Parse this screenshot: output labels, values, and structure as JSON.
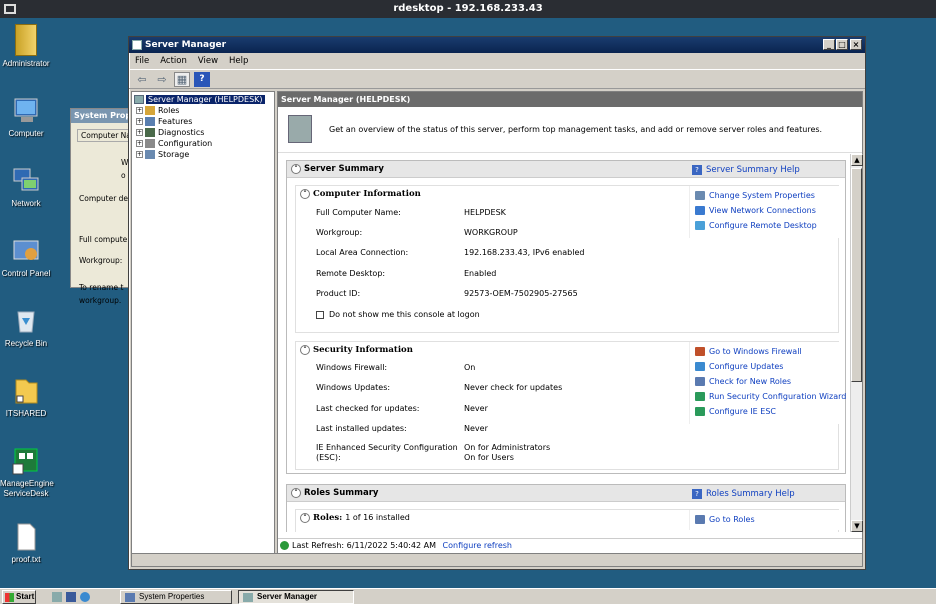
{
  "rdesktop": {
    "title": "rdesktop - 192.168.233.43"
  },
  "desktop": {
    "icons": [
      "Administrator",
      "Computer",
      "Network",
      "Control Panel",
      "Recycle Bin",
      "ITSHARED",
      "ManageEngine ServiceDesk",
      "proof.txt"
    ]
  },
  "bg_window": {
    "title": "System Prope",
    "tab": "Computer Na",
    "lines": [
      "W",
      "o",
      "Computer de",
      "Full compute",
      "Workgroup:",
      "To rename t",
      "workgroup."
    ]
  },
  "window": {
    "title": "Server Manager",
    "menu": [
      "File",
      "Action",
      "View",
      "Help"
    ],
    "controls": {
      "minimize": "_",
      "maximize": "□",
      "close": "×"
    }
  },
  "tree": {
    "root": "Server Manager (HELPDESK)",
    "items": [
      "Roles",
      "Features",
      "Diagnostics",
      "Configuration",
      "Storage"
    ]
  },
  "main": {
    "header": "Server Manager (HELPDESK)",
    "intro": "Get an overview of the status of this server, perform top management tasks, and add or remove server roles and features.",
    "server_summary": {
      "title": "Server Summary",
      "help": "Server Summary Help",
      "computer_info": {
        "title": "Computer Information",
        "rows": [
          {
            "label": "Full Computer Name:",
            "value": "HELPDESK"
          },
          {
            "label": "Workgroup:",
            "value": "WORKGROUP"
          },
          {
            "label": "Local Area Connection:",
            "value": "192.168.233.43, IPv6 enabled"
          },
          {
            "label": "Remote Desktop:",
            "value": "Enabled"
          },
          {
            "label": "Product ID:",
            "value": "92573-OEM-7502905-27565"
          }
        ],
        "checkbox": "Do not show me this console at logon",
        "links": [
          "Change System Properties",
          "View Network Connections",
          "Configure Remote Desktop"
        ]
      },
      "security_info": {
        "title": "Security Information",
        "rows": [
          {
            "label": "Windows Firewall:",
            "value": "On"
          },
          {
            "label": "Windows Updates:",
            "value": "Never check for updates"
          },
          {
            "label": "Last checked for updates:",
            "value": "Never"
          },
          {
            "label": "Last installed updates:",
            "value": "Never"
          }
        ],
        "esc_label_1": "IE Enhanced Security Configuration",
        "esc_label_2": "(ESC):",
        "esc_value_1": "On for Administrators",
        "esc_value_2": "On for Users",
        "links": [
          "Go to Windows Firewall",
          "Configure Updates",
          "Check for New Roles",
          "Run Security Configuration Wizard",
          "Configure IE ESC"
        ]
      }
    },
    "roles_summary": {
      "title": "Roles Summary",
      "help": "Roles Summary Help",
      "roles_label": "Roles:",
      "roles_count": "1 of 16 installed",
      "go_to_roles": "Go to Roles"
    },
    "status": {
      "refresh": "Last Refresh: 6/11/2022 5:40:42 AM",
      "configure": "Configure refresh"
    }
  },
  "taskbar": {
    "start": "Start",
    "tasks": [
      "System Properties",
      "Server Manager"
    ]
  }
}
